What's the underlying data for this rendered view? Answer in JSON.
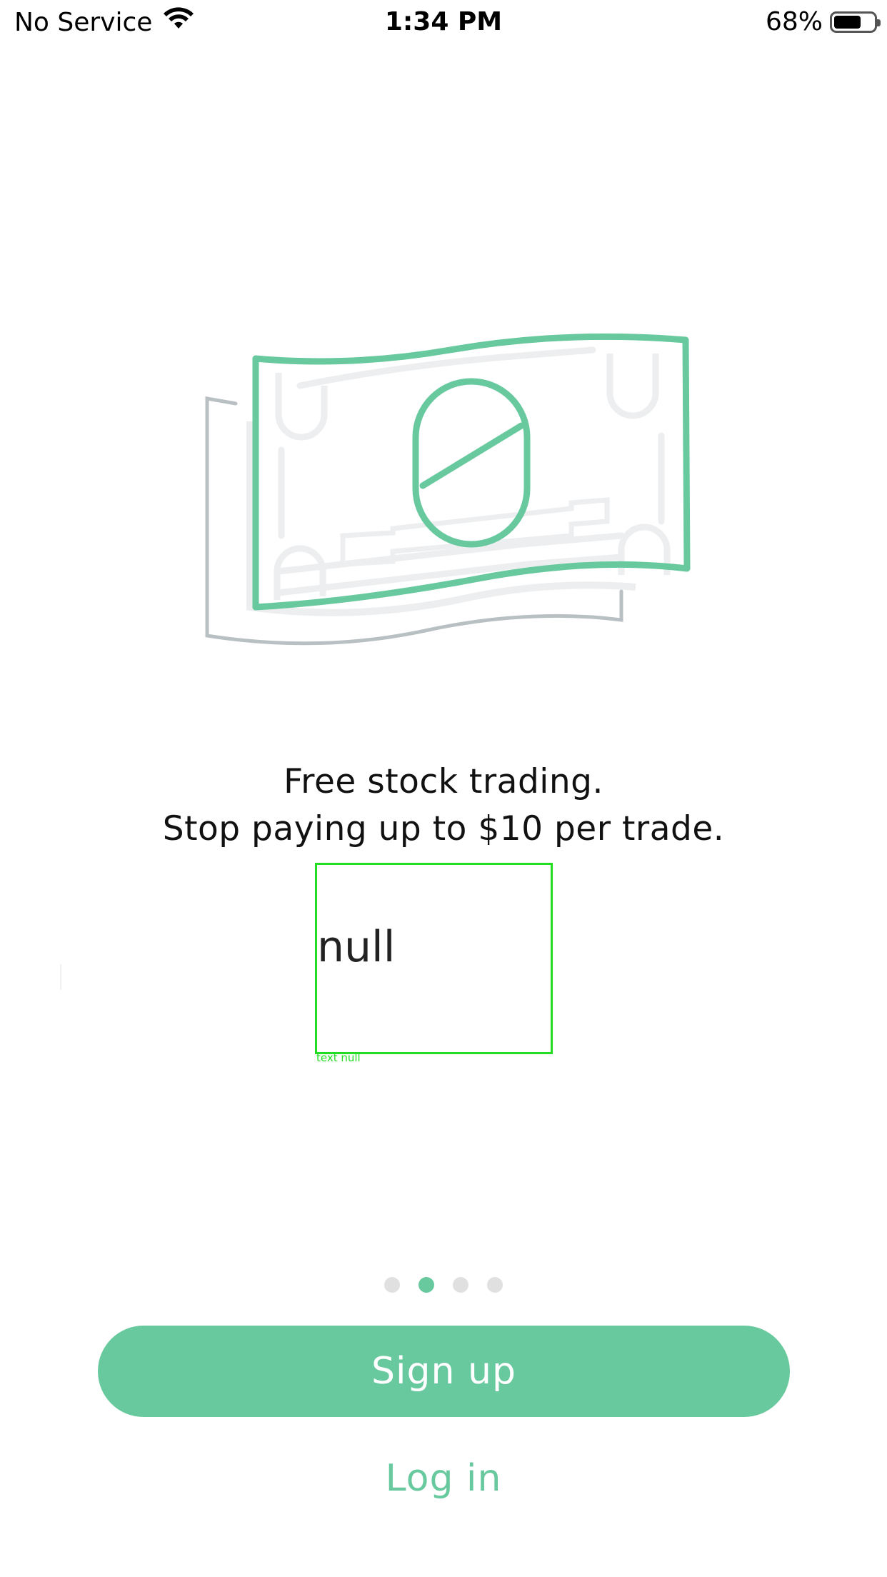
{
  "status_bar": {
    "carrier": "No Service",
    "time": "1:34 PM",
    "battery_percent": "68%",
    "battery_level": 0.68,
    "wifi_icon": "wifi-icon",
    "battery_icon": "battery-icon"
  },
  "illustration": {
    "icon": "dollar-bill-icon",
    "accent_color": "#67c99d",
    "muted_color": "#b8c0c4"
  },
  "headline": {
    "line1": "Free stock trading.",
    "line2": "Stop paying up to $10 per trade."
  },
  "overlay": {
    "value": "null",
    "caption": "text null"
  },
  "pager": {
    "page_count": 4,
    "active_index": 1
  },
  "actions": {
    "signup_label": "Sign up",
    "login_label": "Log in"
  },
  "colors": {
    "accent": "#67c99d",
    "dot_inactive": "#e0e0e0"
  }
}
